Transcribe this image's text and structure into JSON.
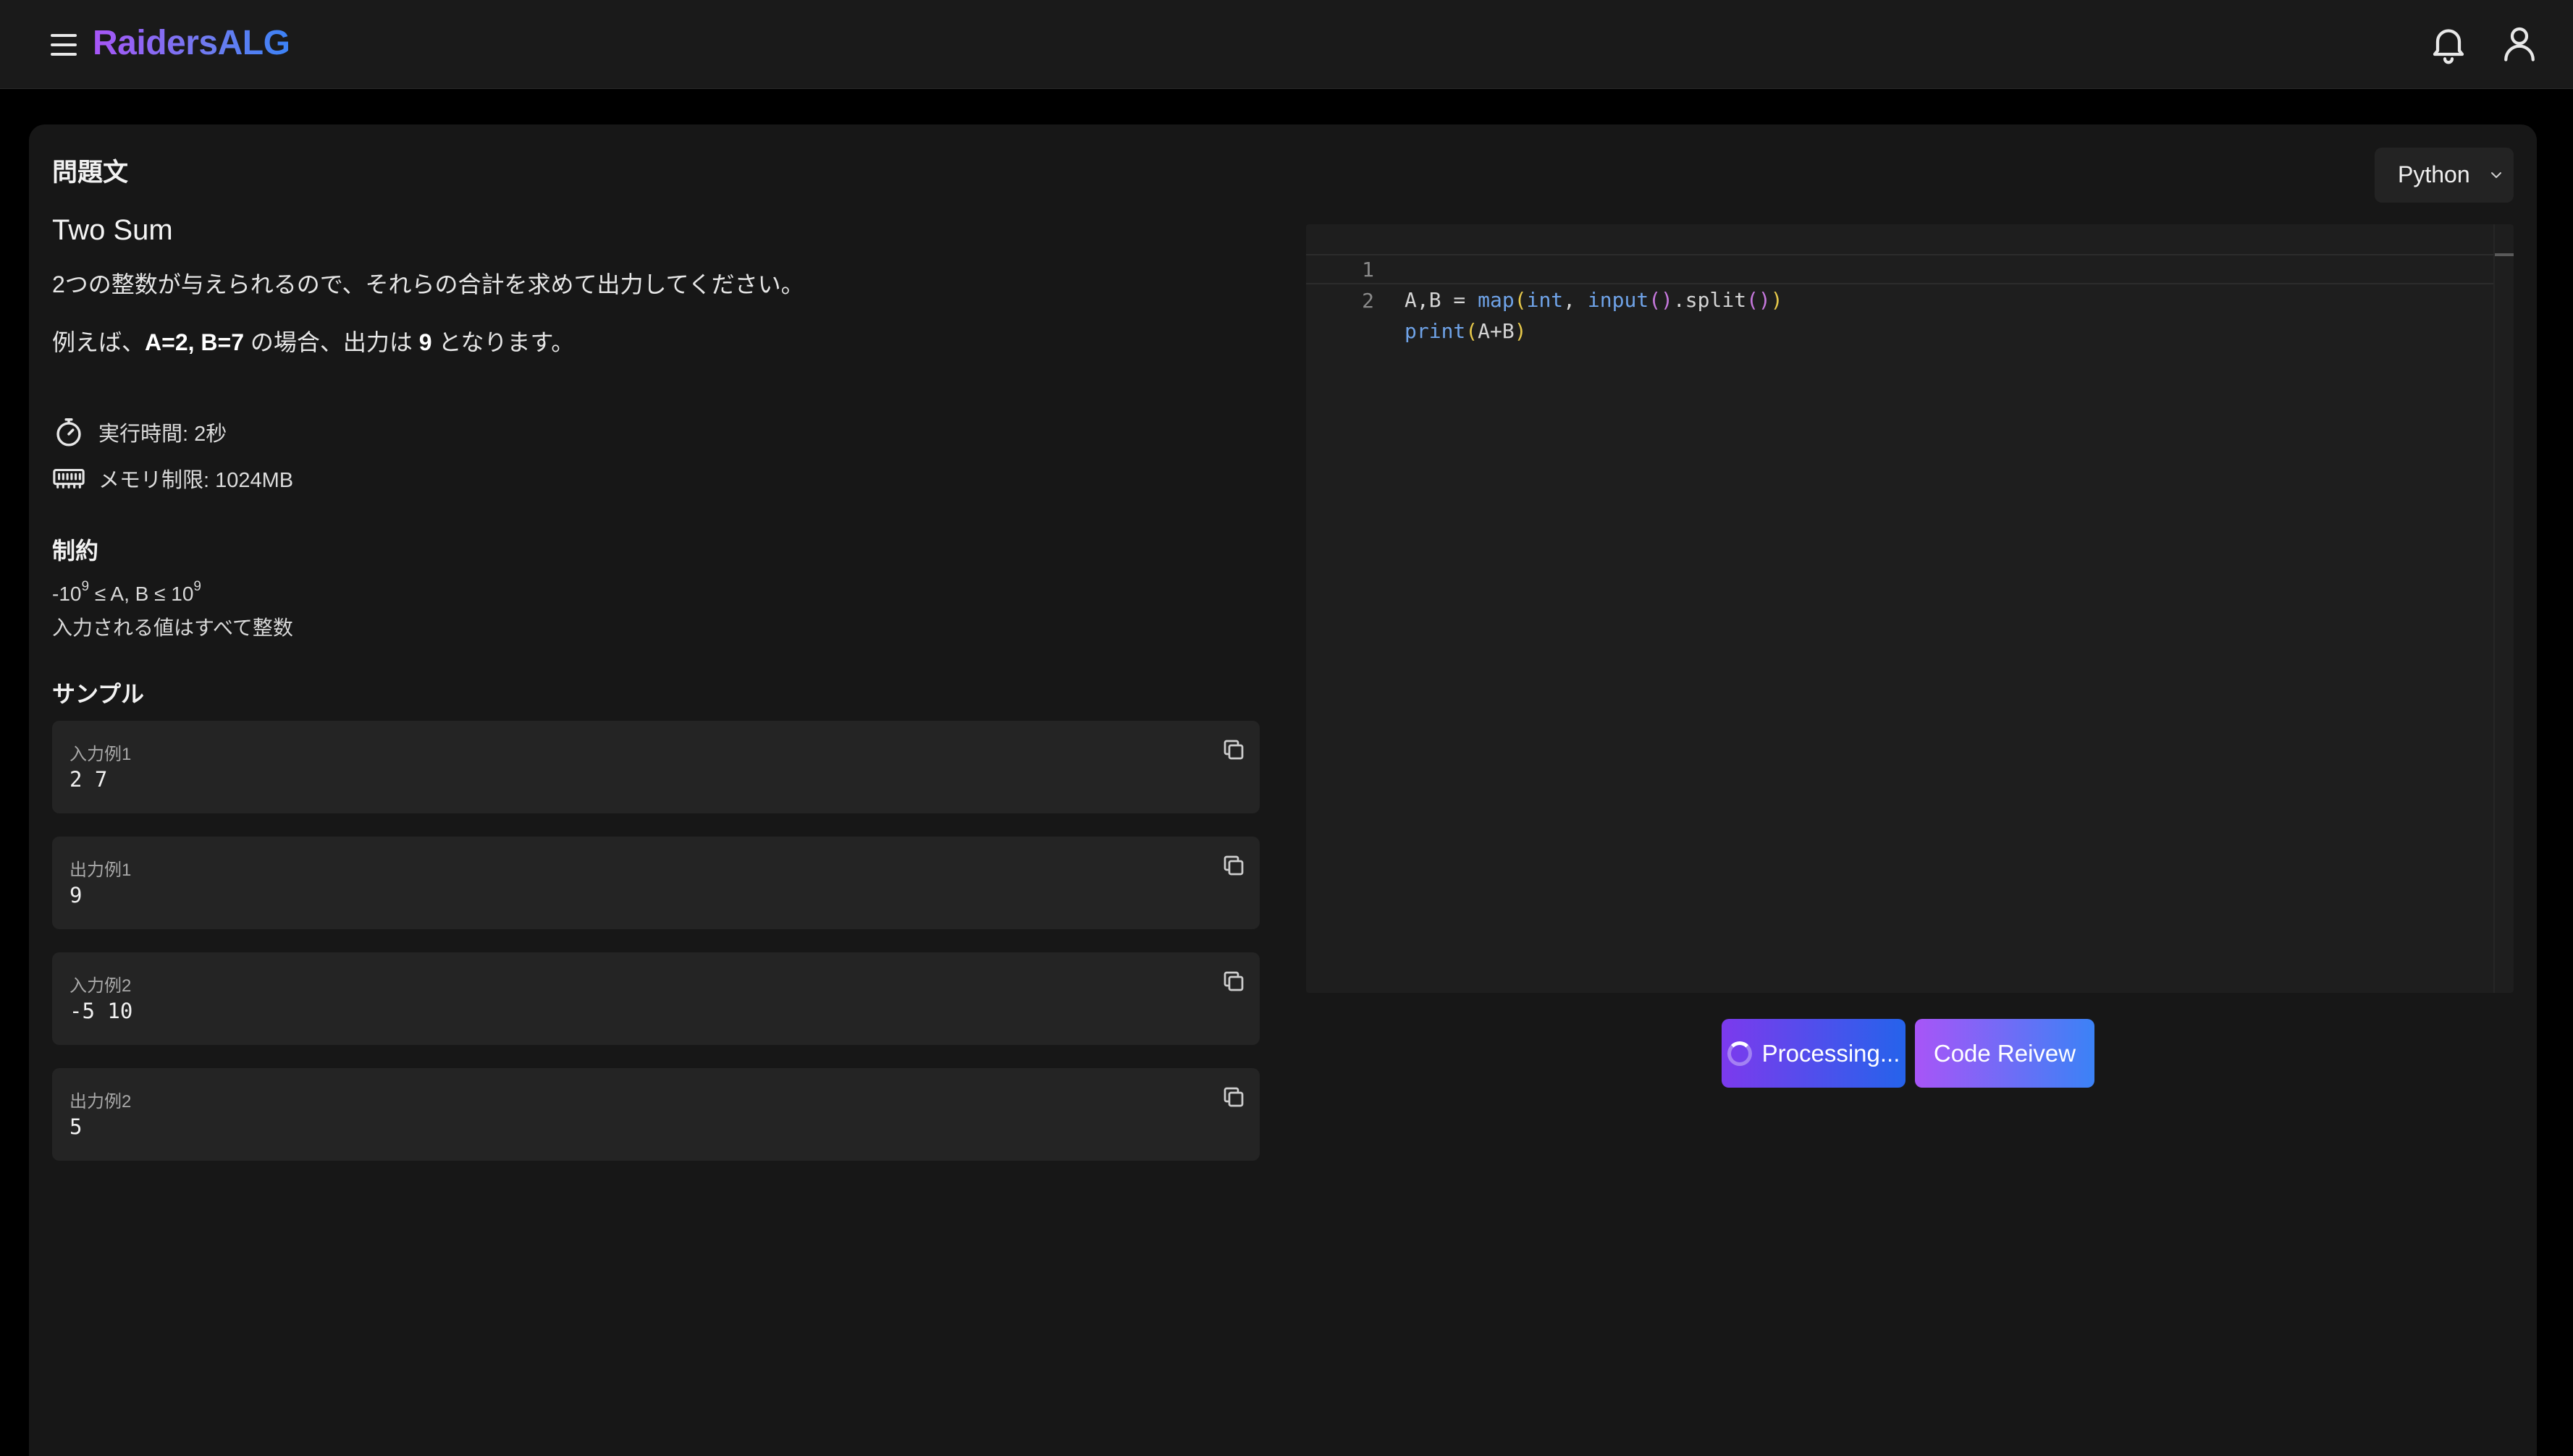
{
  "header": {
    "brand": "RaidersALG",
    "menu_icon": "hamburger-icon",
    "bell_icon": "bell-icon",
    "user_icon": "user-icon"
  },
  "problem": {
    "heading": "問題文",
    "title": "Two Sum",
    "statement": "2つの整数が与えられるので、それらの合計を求めて出力してください。",
    "example": {
      "prefix": "例えば、",
      "params": "A=2, B=7",
      "mid": " の場合、出力は ",
      "answer": "9",
      "suffix": " となります。"
    },
    "time_limit": "実行時間: 2秒",
    "memory_limit": "メモリ制限: 1024MB",
    "constraints_heading": "制約",
    "constraints": {
      "line1": {
        "base1": "-10",
        "exp1": "9",
        "mid": " ≤ A, B ≤ 10",
        "exp2": "9"
      },
      "line2": "入力される値はすべて整数"
    },
    "samples_heading": "サンプル",
    "samples": [
      {
        "label": "入力例1",
        "value": "2 7"
      },
      {
        "label": "出力例1",
        "value": "9"
      },
      {
        "label": "入力例2",
        "value": "-5 10"
      },
      {
        "label": "出力例2",
        "value": "5"
      }
    ]
  },
  "editor": {
    "language": "Python",
    "lines": [
      {
        "number": "1",
        "text": "A,B = map(int, input().split())"
      },
      {
        "number": "2",
        "text": "print(A+B)"
      }
    ]
  },
  "actions": {
    "processing_label": "Processing...",
    "review_label": "Code Reivew"
  },
  "colors": {
    "brand_start": "#a855f7",
    "brand_end": "#3b82f6",
    "background": "#000000",
    "panel": "#171717"
  }
}
